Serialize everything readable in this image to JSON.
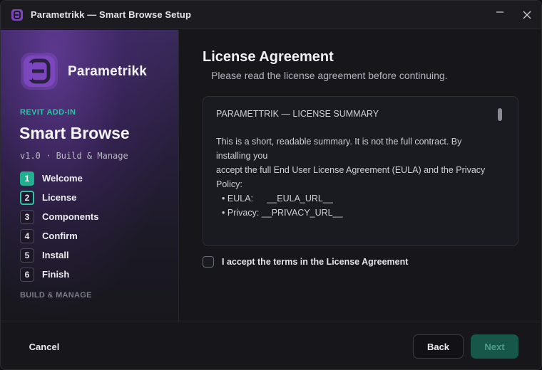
{
  "window": {
    "title": "Parametrikk — Smart Browse Setup",
    "icons": [
      "app-logo-icon",
      "minimize-icon",
      "close-icon"
    ]
  },
  "sidebar": {
    "brand": "Parametrikk",
    "addin_label": "REVIT ADD-IN",
    "product": "Smart Browse",
    "version": "v1.0 · Build & Manage",
    "steps": [
      {
        "num": "1",
        "label": "Welcome",
        "state": "done"
      },
      {
        "num": "2",
        "label": "License",
        "state": "current"
      },
      {
        "num": "3",
        "label": "Components",
        "state": "pending"
      },
      {
        "num": "4",
        "label": "Confirm",
        "state": "pending"
      },
      {
        "num": "5",
        "label": "Install",
        "state": "pending"
      },
      {
        "num": "6",
        "label": "Finish",
        "state": "pending"
      }
    ],
    "footer": "BUILD & MANAGE"
  },
  "main": {
    "title": "License Agreement",
    "subtitle": "Please read the license agreement before continuing.",
    "license": {
      "heading": "PARAMETTRIK — LICENSE SUMMARY",
      "para_line1": "This is a short, readable summary. It is not the full contract. By",
      "para_line2": "installing you",
      "para_line3": "accept the full End User License Agreement (EULA) and the Privacy",
      "para_line4": "Policy:",
      "bullets": [
        {
          "key": "EULA:",
          "value": "__EULA_URL__"
        },
        {
          "key": "Privacy:",
          "value": "__PRIVACY_URL__"
        }
      ]
    },
    "accept_label": "I accept the terms in the License Agreement"
  },
  "footer": {
    "cancel_label": "Cancel",
    "back_label": "Back",
    "next_label": "Next"
  },
  "colors": {
    "accent": "#21b08f",
    "accent_text": "#2fc4a4",
    "brand_purple": "#7c46be",
    "next_disabled_bg": "#17574a"
  }
}
